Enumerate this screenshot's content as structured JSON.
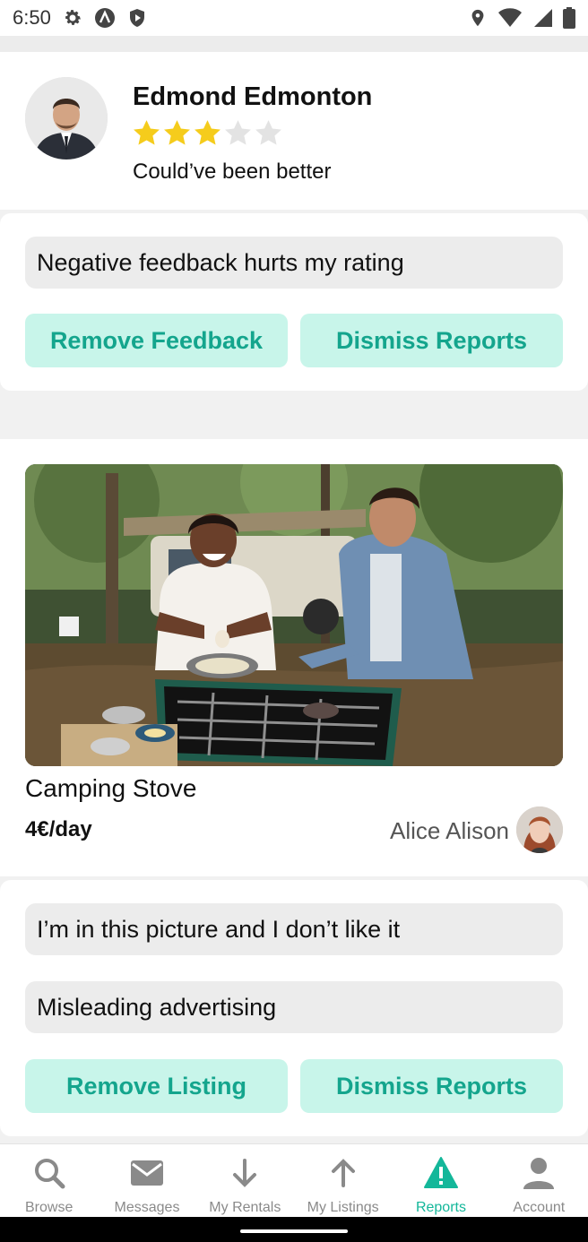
{
  "statusbar": {
    "time": "6:50"
  },
  "profile": {
    "name": "Edmond Edmonton",
    "rating": 3,
    "rating_max": 5,
    "comment": "Could’ve been better"
  },
  "feedback_report": {
    "reason": "Negative feedback hurts my rating",
    "remove_label": "Remove Feedback",
    "dismiss_label": "Dismiss Reports"
  },
  "listing": {
    "title": "Camping Stove",
    "price": "4€/day",
    "owner": "Alice Alison"
  },
  "listing_report": {
    "reasons": [
      "I’m in this picture and I don’t like it",
      "Misleading advertising"
    ],
    "remove_label": "Remove Listing",
    "dismiss_label": "Dismiss Reports"
  },
  "nav": {
    "items": [
      {
        "label": "Browse",
        "icon": "search-icon"
      },
      {
        "label": "Messages",
        "icon": "envelope-icon"
      },
      {
        "label": "My Rentals",
        "icon": "arrow-down-icon"
      },
      {
        "label": "My Listings",
        "icon": "arrow-up-icon"
      },
      {
        "label": "Reports",
        "icon": "warning-icon"
      },
      {
        "label": "Account",
        "icon": "person-icon"
      }
    ],
    "active_index": 4
  },
  "colors": {
    "accent": "#14b79a",
    "button_bg": "#c8f5ea",
    "button_text": "#14a58d",
    "star": "#f5cc1c"
  }
}
